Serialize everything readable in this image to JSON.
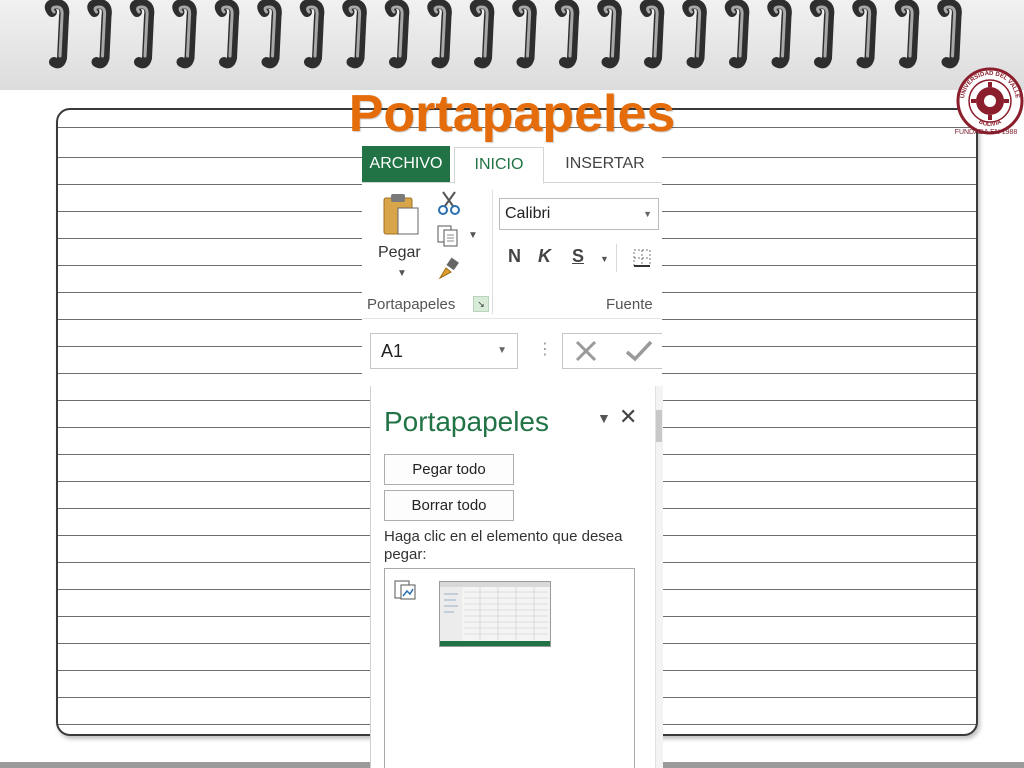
{
  "slide": {
    "title": "Portapapeles"
  },
  "logo": {
    "ring_text_top": "UNIVERSIDAD DEL VALLE",
    "ring_text_bottom": "BOLIVIA",
    "caption": "FUNDADA EN 1988"
  },
  "ribbon": {
    "tabs": [
      {
        "label": "ARCHIVO",
        "state": "file-tab"
      },
      {
        "label": "INICIO",
        "state": "selected"
      },
      {
        "label": "INSERTAR",
        "state": "normal"
      }
    ],
    "clipboard_group": {
      "paste_label": "Pegar",
      "group_label": "Portapapeles"
    },
    "font_group": {
      "font_name": "Calibri",
      "bold": "N",
      "italic": "K",
      "underline": "S",
      "group_label": "Fuente"
    }
  },
  "formula_bar": {
    "name_box": "A1"
  },
  "clipboard_pane": {
    "title": "Portapapeles",
    "paste_all_label": "Pegar todo",
    "clear_all_label": "Borrar todo",
    "instruction": "Haga clic en el elemento que desea pegar:"
  },
  "colors": {
    "title_orange": "#e46c0a",
    "excel_green": "#217346"
  }
}
